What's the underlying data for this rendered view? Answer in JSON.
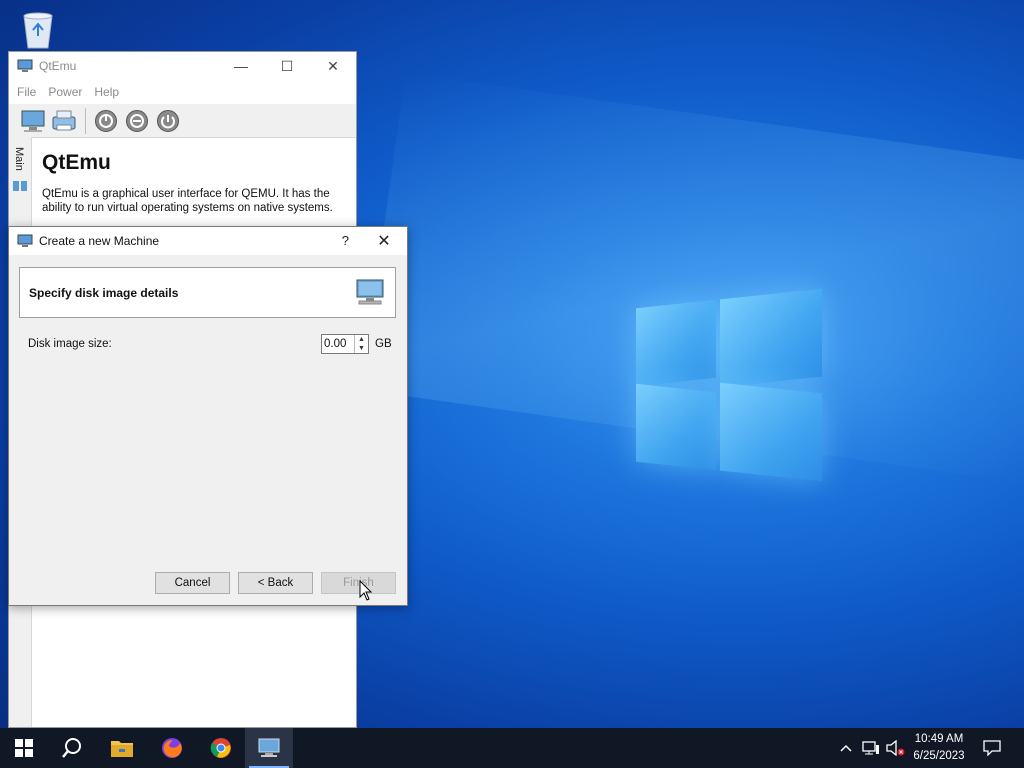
{
  "desktop": {
    "recycle_bin_icon": "recycle-bin-icon"
  },
  "main_window": {
    "title": "QtEmu",
    "controls": {
      "minimize": "—",
      "maximize": "☐",
      "close": "✕"
    },
    "menu": [
      "File",
      "Power",
      "Help"
    ],
    "side_tab": "Main",
    "heading": "QtEmu",
    "description": "QtEmu is a graphical user interface for QEMU. It has the ability to run virtual operating systems on native systems."
  },
  "dialog": {
    "title": "Create a new Machine",
    "help": "?",
    "close": "✕",
    "header_text": "Specify disk image details",
    "disk_label": "Disk image size:",
    "disk_value": "0.00",
    "disk_unit": "GB",
    "buttons": {
      "cancel": "Cancel",
      "back": "< Back",
      "finish": "Finish"
    }
  },
  "taskbar": {
    "time": "10:49 AM",
    "date": "6/25/2023",
    "tray_chevron": "^"
  },
  "colors": {
    "accent": "#0078d7",
    "taskbar": "#101826",
    "dialog_bg": "#f0f0f0"
  }
}
